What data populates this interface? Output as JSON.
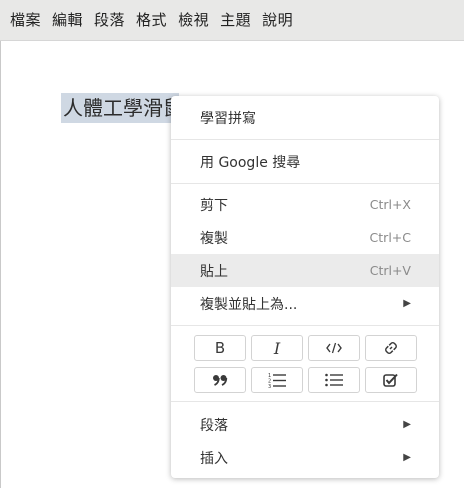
{
  "menubar": {
    "items": [
      "檔案",
      "編輯",
      "段落",
      "格式",
      "檢視",
      "主題",
      "說明"
    ]
  },
  "editor": {
    "selected_text": "人體工學滑鼠"
  },
  "context_menu": {
    "learn_spelling": "學習拼寫",
    "google_search": "用 Google 搜尋",
    "cut": {
      "label": "剪下",
      "shortcut": "Ctrl+X"
    },
    "copy": {
      "label": "複製",
      "shortcut": "Ctrl+C"
    },
    "paste": {
      "label": "貼上",
      "shortcut": "Ctrl+V"
    },
    "copy_paste_as": "複製並貼上為...",
    "paragraph": "段落",
    "insert": "插入",
    "format_buttons": {
      "bold": "B",
      "italic": "I"
    }
  },
  "icons": {
    "code": "code-icon",
    "link": "link-icon",
    "quote": "quote-icon",
    "ordered_list": "ordered-list-icon",
    "bullet_list": "bullet-list-icon",
    "task_list": "checkbox-icon",
    "submenu": "chevron-right-icon"
  },
  "colors": {
    "selection": "#cfd8e3",
    "menubar_bg": "#e8e8e7",
    "hover_bg": "#ebebeb"
  }
}
